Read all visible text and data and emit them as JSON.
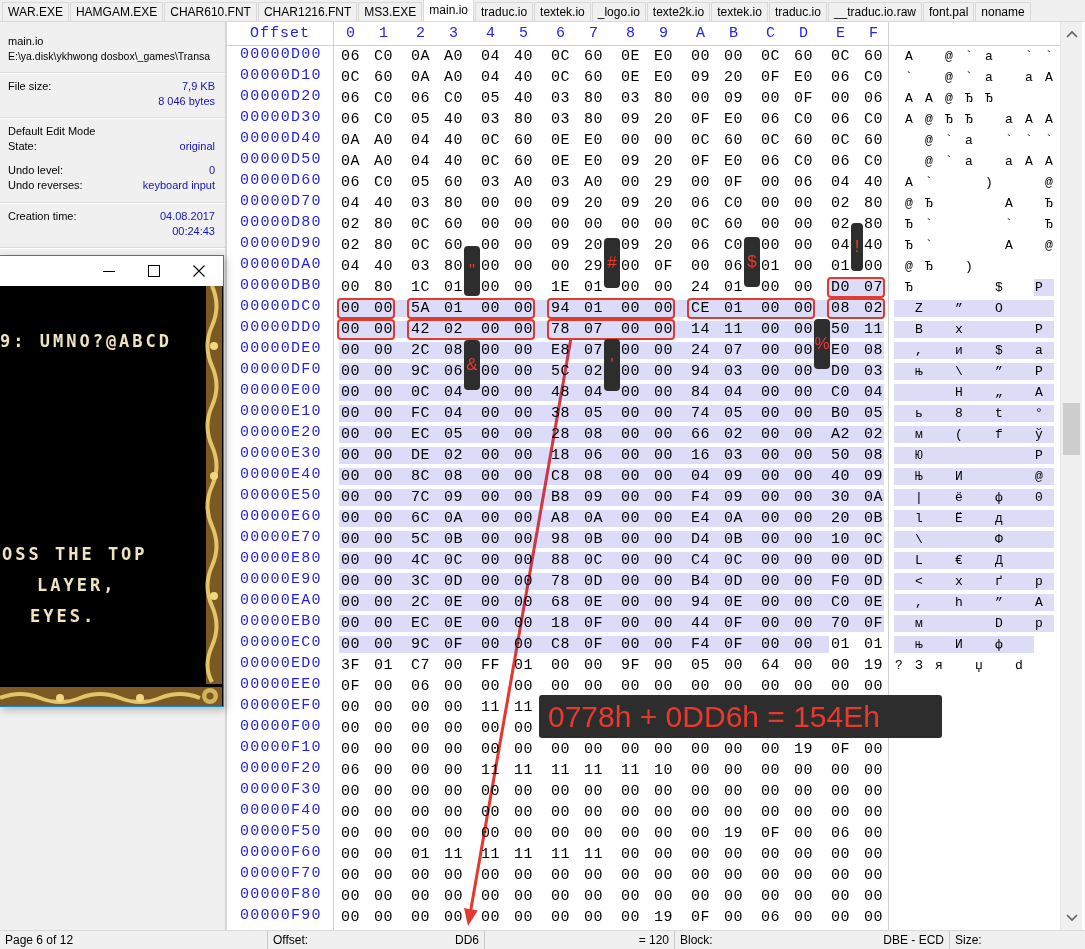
{
  "tabs": [
    {
      "label": "WAR.EXE",
      "selected": false
    },
    {
      "label": "HAMGAM.EXE",
      "selected": false
    },
    {
      "label": "CHAR610.FNT",
      "selected": false
    },
    {
      "label": "CHAR1216.FNT",
      "selected": false
    },
    {
      "label": "MS3.EXE",
      "selected": false
    },
    {
      "label": "main.io",
      "selected": true
    },
    {
      "label": "traduc.io",
      "selected": false
    },
    {
      "label": "textek.io",
      "selected": false
    },
    {
      "label": "_logo.io",
      "selected": false
    },
    {
      "label": "texte2k.io",
      "selected": false
    },
    {
      "label": "textek.io",
      "selected": false
    },
    {
      "label": "traduc.io",
      "selected": false
    },
    {
      "label": "__traduc.io.raw",
      "selected": false
    },
    {
      "label": "font.pal",
      "selected": false
    },
    {
      "label": "noname",
      "selected": false
    }
  ],
  "info_panel": {
    "file_name": "main.io",
    "path": "E:\\ya.disk\\ykhwong dosbox\\_games\\Transa",
    "file_size_label": "File size:",
    "file_size_kb": "7,9 KB",
    "file_size_bytes": "8 046 bytes",
    "edit_mode": "Default Edit Mode",
    "state_label": "State:",
    "state": "original",
    "undo_level_label": "Undo level:",
    "undo_level": "0",
    "undo_reverses_label": "Undo reverses:",
    "undo_reverses": "keyboard input",
    "creation_time_label": "Creation time:",
    "creation_date": "04.08.2017",
    "creation_clock": "00:24:43"
  },
  "overlay_window": {
    "lines": [
      "9: UMNO?@ABCD",
      "OSS THE TOP",
      "LAYER,",
      "EYES."
    ]
  },
  "hex_view": {
    "offset_header": "Offset",
    "column_headers": [
      "0",
      "1",
      "2",
      "3",
      "4",
      "5",
      "6",
      "7",
      "8",
      "9",
      "A",
      "B",
      "C",
      "D",
      "E",
      "F"
    ],
    "rows": [
      {
        "offset": "00000D00",
        "bytes": [
          "06",
          "C0",
          "0A",
          "A0",
          "04",
          "40",
          "0C",
          "60",
          "0E",
          "E0",
          "00",
          "00",
          "0C",
          "60",
          "0C",
          "60"
        ],
        "selected": [
          false,
          false,
          false,
          false,
          false,
          false,
          false,
          false,
          false,
          false,
          false,
          false,
          false,
          false,
          false,
          false
        ],
        "text": [
          " А   @ ` а   ` `"
        ]
      },
      {
        "offset": "00000D10",
        "bytes": [
          "0C",
          "60",
          "0A",
          "A0",
          "04",
          "40",
          "0C",
          "60",
          "0E",
          "E0",
          "09",
          "20",
          "0F",
          "E0",
          "06",
          "C0"
        ],
        "selected": [
          false,
          false,
          false,
          false,
          false,
          false,
          false,
          false,
          false,
          false,
          false,
          false,
          false,
          false,
          false,
          false
        ],
        "text": [
          " `   @ ` а   а А"
        ]
      },
      {
        "offset": "00000D20",
        "bytes": [
          "06",
          "C0",
          "06",
          "C0",
          "05",
          "40",
          "03",
          "80",
          "03",
          "80",
          "00",
          "09",
          "00",
          "0F",
          "00",
          "06"
        ],
        "selected": [
          false,
          false,
          false,
          false,
          false,
          false,
          false,
          false,
          false,
          false,
          false,
          false,
          false,
          false,
          false,
          false
        ],
        "text": [
          " А А @ Ђ Ђ"
        ]
      },
      {
        "offset": "00000D30",
        "bytes": [
          "06",
          "C0",
          "05",
          "40",
          "03",
          "80",
          "03",
          "80",
          "09",
          "20",
          "0F",
          "E0",
          "06",
          "C0",
          "06",
          "C0"
        ],
        "selected": [
          false,
          false,
          false,
          false,
          false,
          false,
          false,
          false,
          false,
          false,
          false,
          false,
          false,
          false,
          false,
          false
        ],
        "text": [
          " А @ Ђ Ђ   а А А"
        ]
      },
      {
        "offset": "00000D40",
        "bytes": [
          "0A",
          "A0",
          "04",
          "40",
          "0C",
          "60",
          "0E",
          "E0",
          "00",
          "00",
          "0C",
          "60",
          "0C",
          "60",
          "0C",
          "60"
        ],
        "selected": [
          false,
          false,
          false,
          false,
          false,
          false,
          false,
          false,
          false,
          false,
          false,
          false,
          false,
          false,
          false,
          false
        ],
        "text": [
          "   @ ` а   ` ` `"
        ]
      },
      {
        "offset": "00000D50",
        "bytes": [
          "0A",
          "A0",
          "04",
          "40",
          "0C",
          "60",
          "0E",
          "E0",
          "09",
          "20",
          "0F",
          "E0",
          "06",
          "C0",
          "06",
          "C0"
        ],
        "selected": [
          false,
          false,
          false,
          false,
          false,
          false,
          false,
          false,
          false,
          false,
          false,
          false,
          false,
          false,
          false,
          false
        ],
        "text": [
          "   @ ` а   а А А"
        ]
      },
      {
        "offset": "00000D60",
        "bytes": [
          "06",
          "C0",
          "05",
          "60",
          "03",
          "A0",
          "03",
          "A0",
          "00",
          "29",
          "00",
          "0F",
          "00",
          "06",
          "04",
          "40"
        ],
        "selected": [
          false,
          false,
          false,
          false,
          false,
          false,
          false,
          false,
          false,
          false,
          false,
          false,
          false,
          false,
          false,
          false
        ],
        "text": [
          " А `     )     @"
        ]
      },
      {
        "offset": "00000D70",
        "bytes": [
          "04",
          "40",
          "03",
          "80",
          "00",
          "00",
          "09",
          "20",
          "09",
          "20",
          "06",
          "C0",
          "00",
          "00",
          "02",
          "80"
        ],
        "selected": [
          false,
          false,
          false,
          false,
          false,
          false,
          false,
          false,
          false,
          false,
          false,
          false,
          false,
          false,
          false,
          false
        ],
        "text": [
          " @ Ђ       А   Ђ"
        ]
      },
      {
        "offset": "00000D80",
        "bytes": [
          "02",
          "80",
          "0C",
          "60",
          "00",
          "00",
          "00",
          "00",
          "00",
          "00",
          "0C",
          "60",
          "00",
          "00",
          "02",
          "80"
        ],
        "selected": [
          false,
          false,
          false,
          false,
          false,
          false,
          false,
          false,
          false,
          false,
          false,
          false,
          false,
          false,
          false,
          false
        ],
        "text": [
          " Ђ `       `   Ђ"
        ]
      },
      {
        "offset": "00000D90",
        "bytes": [
          "02",
          "80",
          "0C",
          "60",
          "00",
          "00",
          "09",
          "20",
          "09",
          "20",
          "06",
          "C0",
          "00",
          "00",
          "04",
          "40"
        ],
        "selected": [
          false,
          false,
          false,
          false,
          false,
          false,
          false,
          false,
          false,
          false,
          false,
          false,
          false,
          false,
          false,
          false
        ],
        "text": [
          " Ђ `       А   @"
        ]
      },
      {
        "offset": "00000DA0",
        "bytes": [
          "04",
          "40",
          "03",
          "80",
          "00",
          "00",
          "00",
          "29",
          "00",
          "0F",
          "00",
          "06",
          "01",
          "00",
          "01",
          "00"
        ],
        "selected": [
          false,
          false,
          false,
          false,
          false,
          false,
          false,
          false,
          false,
          false,
          false,
          false,
          false,
          false,
          false,
          false
        ],
        "text": [
          " @ Ђ   )"
        ]
      },
      {
        "offset": "00000DB0",
        "bytes": [
          "00",
          "80",
          "1C",
          "01",
          "00",
          "00",
          "1E",
          "01",
          "00",
          "00",
          "24",
          "01",
          "00",
          "00",
          "D0",
          "07"
        ],
        "selected": [
          false,
          false,
          false,
          false,
          false,
          false,
          false,
          false,
          false,
          false,
          false,
          false,
          false,
          false,
          true,
          true
        ],
        "text": [
          " Ђ",
          "        $   Р"
        ]
      },
      {
        "offset": "00000DC0",
        "bytes": [
          "00",
          "00",
          "5A",
          "01",
          "00",
          "00",
          "94",
          "01",
          "00",
          "00",
          "CE",
          "01",
          "00",
          "00",
          "08",
          "02"
        ],
        "selected": [
          true,
          true,
          true,
          true,
          true,
          true,
          true,
          true,
          true,
          true,
          true,
          true,
          true,
          true,
          true,
          true
        ],
        "text": [
          "  Z   ”   О"
        ]
      },
      {
        "offset": "00000DD0",
        "bytes": [
          "00",
          "00",
          "42",
          "02",
          "00",
          "00",
          "78",
          "07",
          "00",
          "00",
          "14",
          "11",
          "00",
          "00",
          "50",
          "11"
        ],
        "selected": [
          true,
          true,
          true,
          true,
          true,
          true,
          true,
          true,
          true,
          true,
          true,
          true,
          true,
          true,
          true,
          true
        ],
        "text": [
          "  B   x       P"
        ]
      },
      {
        "offset": "00000DE0",
        "bytes": [
          "00",
          "00",
          "2C",
          "08",
          "00",
          "00",
          "E8",
          "07",
          "00",
          "00",
          "24",
          "07",
          "00",
          "00",
          "E0",
          "08"
        ],
        "selected": [
          true,
          true,
          true,
          true,
          true,
          true,
          true,
          true,
          true,
          true,
          true,
          true,
          true,
          true,
          true,
          true
        ],
        "text": [
          "  ,   и   $   а"
        ]
      },
      {
        "offset": "00000DF0",
        "bytes": [
          "00",
          "00",
          "9C",
          "06",
          "00",
          "00",
          "5C",
          "02",
          "00",
          "00",
          "94",
          "03",
          "00",
          "00",
          "D0",
          "03"
        ],
        "selected": [
          true,
          true,
          true,
          true,
          true,
          true,
          true,
          true,
          true,
          true,
          true,
          true,
          true,
          true,
          true,
          true
        ],
        "text": [
          "  њ   \\   ”   Р"
        ]
      },
      {
        "offset": "00000E00",
        "bytes": [
          "00",
          "00",
          "0C",
          "04",
          "00",
          "00",
          "48",
          "04",
          "00",
          "00",
          "84",
          "04",
          "00",
          "00",
          "C0",
          "04"
        ],
        "selected": [
          true,
          true,
          true,
          true,
          true,
          true,
          true,
          true,
          true,
          true,
          true,
          true,
          true,
          true,
          true,
          true
        ],
        "text": [
          "      H   „   А"
        ]
      },
      {
        "offset": "00000E10",
        "bytes": [
          "00",
          "00",
          "FC",
          "04",
          "00",
          "00",
          "38",
          "05",
          "00",
          "00",
          "74",
          "05",
          "00",
          "00",
          "B0",
          "05"
        ],
        "selected": [
          true,
          true,
          true,
          true,
          true,
          true,
          true,
          true,
          true,
          true,
          true,
          true,
          true,
          true,
          true,
          true
        ],
        "text": [
          "  ь   8   t   °"
        ]
      },
      {
        "offset": "00000E20",
        "bytes": [
          "00",
          "00",
          "EC",
          "05",
          "00",
          "00",
          "28",
          "08",
          "00",
          "00",
          "66",
          "02",
          "00",
          "00",
          "A2",
          "02"
        ],
        "selected": [
          true,
          true,
          true,
          true,
          true,
          true,
          true,
          true,
          true,
          true,
          true,
          true,
          true,
          true,
          true,
          true
        ],
        "text": [
          "  м   (   f   ў"
        ]
      },
      {
        "offset": "00000E30",
        "bytes": [
          "00",
          "00",
          "DE",
          "02",
          "00",
          "00",
          "18",
          "06",
          "00",
          "00",
          "16",
          "03",
          "00",
          "00",
          "50",
          "08"
        ],
        "selected": [
          true,
          true,
          true,
          true,
          true,
          true,
          true,
          true,
          true,
          true,
          true,
          true,
          true,
          true,
          true,
          true
        ],
        "text": [
          "  Ю",
          "           P"
        ]
      },
      {
        "offset": "00000E40",
        "bytes": [
          "00",
          "00",
          "8C",
          "08",
          "00",
          "00",
          "C8",
          "08",
          "00",
          "00",
          "04",
          "09",
          "00",
          "00",
          "40",
          "09"
        ],
        "selected": [
          true,
          true,
          true,
          true,
          true,
          true,
          true,
          true,
          true,
          true,
          true,
          true,
          true,
          true,
          true,
          true
        ],
        "text": [
          "  Њ   И       @"
        ]
      },
      {
        "offset": "00000E50",
        "bytes": [
          "00",
          "00",
          "7C",
          "09",
          "00",
          "00",
          "B8",
          "09",
          "00",
          "00",
          "F4",
          "09",
          "00",
          "00",
          "30",
          "0A"
        ],
        "selected": [
          true,
          true,
          true,
          true,
          true,
          true,
          true,
          true,
          true,
          true,
          true,
          true,
          true,
          true,
          true,
          true
        ],
        "text": [
          "  |   ё   ф   0"
        ]
      },
      {
        "offset": "00000E60",
        "bytes": [
          "00",
          "00",
          "6C",
          "0A",
          "00",
          "00",
          "A8",
          "0A",
          "00",
          "00",
          "E4",
          "0A",
          "00",
          "00",
          "20",
          "0B"
        ],
        "selected": [
          true,
          true,
          true,
          true,
          true,
          true,
          true,
          true,
          true,
          true,
          true,
          true,
          true,
          true,
          true,
          true
        ],
        "text": [
          "  l   Ё   д"
        ]
      },
      {
        "offset": "00000E70",
        "bytes": [
          "00",
          "00",
          "5C",
          "0B",
          "00",
          "00",
          "98",
          "0B",
          "00",
          "00",
          "D4",
          "0B",
          "00",
          "00",
          "10",
          "0C"
        ],
        "selected": [
          true,
          true,
          true,
          true,
          true,
          true,
          true,
          true,
          true,
          true,
          true,
          true,
          true,
          true,
          true,
          true
        ],
        "text": [
          "  \\       Ф"
        ]
      },
      {
        "offset": "00000E80",
        "bytes": [
          "00",
          "00",
          "4C",
          "0C",
          "00",
          "00",
          "88",
          "0C",
          "00",
          "00",
          "C4",
          "0C",
          "00",
          "00",
          "00",
          "0D"
        ],
        "selected": [
          true,
          true,
          true,
          true,
          true,
          true,
          true,
          true,
          true,
          true,
          true,
          true,
          true,
          true,
          true,
          true
        ],
        "text": [
          "  L   €   Д"
        ]
      },
      {
        "offset": "00000E90",
        "bytes": [
          "00",
          "00",
          "3C",
          "0D",
          "00",
          "00",
          "78",
          "0D",
          "00",
          "00",
          "B4",
          "0D",
          "00",
          "00",
          "F0",
          "0D"
        ],
        "selected": [
          true,
          true,
          true,
          true,
          true,
          true,
          true,
          true,
          true,
          true,
          true,
          true,
          true,
          true,
          true,
          true
        ],
        "text": [
          "  <   x   ґ   р"
        ]
      },
      {
        "offset": "00000EA0",
        "bytes": [
          "00",
          "00",
          "2C",
          "0E",
          "00",
          "00",
          "68",
          "0E",
          "00",
          "00",
          "94",
          "0E",
          "00",
          "00",
          "C0",
          "0E"
        ],
        "selected": [
          true,
          true,
          true,
          true,
          true,
          true,
          true,
          true,
          true,
          true,
          true,
          true,
          true,
          true,
          true,
          true
        ],
        "text": [
          "  ,   h   ”   А"
        ]
      },
      {
        "offset": "00000EB0",
        "bytes": [
          "00",
          "00",
          "EC",
          "0E",
          "00",
          "00",
          "18",
          "0F",
          "00",
          "00",
          "44",
          "0F",
          "00",
          "00",
          "70",
          "0F"
        ],
        "selected": [
          true,
          true,
          true,
          true,
          true,
          true,
          true,
          true,
          true,
          true,
          true,
          true,
          true,
          true,
          true,
          true
        ],
        "text": [
          "  м       D   p"
        ]
      },
      {
        "offset": "00000EC0",
        "bytes": [
          "00",
          "00",
          "9C",
          "0F",
          "00",
          "00",
          "C8",
          "0F",
          "00",
          "00",
          "F4",
          "0F",
          "00",
          "00",
          "01",
          "01"
        ],
        "selected": [
          true,
          true,
          true,
          true,
          true,
          true,
          true,
          true,
          true,
          true,
          true,
          true,
          true,
          true,
          false,
          false
        ],
        "text": [
          "  њ   И   ф"
        ]
      },
      {
        "offset": "00000ED0",
        "bytes": [
          "3F",
          "01",
          "C7",
          "00",
          "FF",
          "01",
          "00",
          "00",
          "9F",
          "00",
          "05",
          "00",
          "64",
          "00",
          "00",
          "19"
        ],
        "selected": [
          false,
          false,
          false,
          false,
          false,
          false,
          false,
          false,
          false,
          false,
          false,
          false,
          false,
          false,
          false,
          false
        ],
        "text": [
          "? З я   џ   d"
        ]
      },
      {
        "offset": "00000EE0",
        "bytes": [
          "0F",
          "00",
          "06",
          "00",
          "00",
          "00",
          "00",
          "00",
          "00",
          "00",
          "00",
          "00",
          "00",
          "00",
          "00",
          "00"
        ],
        "selected": [
          false,
          false,
          false,
          false,
          false,
          false,
          false,
          false,
          false,
          false,
          false,
          false,
          false,
          false,
          false,
          false
        ]
      },
      {
        "offset": "00000EF0",
        "bytes": [
          "00",
          "00",
          "00",
          "00",
          "11",
          "11"
        ],
        "selected": [
          false,
          false,
          false,
          false,
          false,
          false
        ]
      },
      {
        "offset": "00000F00",
        "bytes": [
          "00",
          "00",
          "00",
          "00",
          "00",
          "00"
        ],
        "selected": [
          false,
          false,
          false,
          false,
          false,
          false
        ]
      },
      {
        "offset": "00000F10",
        "bytes": [
          "00",
          "00",
          "00",
          "00",
          "00",
          "00",
          "00",
          "00",
          "00",
          "00",
          "00",
          "00",
          "00",
          "19",
          "0F",
          "00"
        ],
        "selected": [
          false,
          false,
          false,
          false,
          false,
          false,
          false,
          false,
          false,
          false,
          false,
          false,
          false,
          false,
          false,
          false
        ]
      },
      {
        "offset": "00000F20",
        "bytes": [
          "06",
          "00",
          "00",
          "00",
          "11",
          "11",
          "11",
          "11",
          "11",
          "10",
          "00",
          "00",
          "00",
          "00",
          "00",
          "00"
        ],
        "selected": [
          false,
          false,
          false,
          false,
          false,
          false,
          false,
          false,
          false,
          false,
          false,
          false,
          false,
          false,
          false,
          false
        ]
      },
      {
        "offset": "00000F30",
        "bytes": [
          "00",
          "00",
          "00",
          "00",
          "00",
          "00",
          "00",
          "00",
          "00",
          "00",
          "00",
          "00",
          "00",
          "00",
          "00",
          "00"
        ],
        "selected": [
          false,
          false,
          false,
          false,
          false,
          false,
          false,
          false,
          false,
          false,
          false,
          false,
          false,
          false,
          false,
          false
        ]
      },
      {
        "offset": "00000F40",
        "bytes": [
          "00",
          "00",
          "00",
          "00",
          "00",
          "00",
          "00",
          "00",
          "00",
          "00",
          "00",
          "00",
          "00",
          "00",
          "00",
          "00"
        ],
        "selected": [
          false,
          false,
          false,
          false,
          false,
          false,
          false,
          false,
          false,
          false,
          false,
          false,
          false,
          false,
          false,
          false
        ]
      },
      {
        "offset": "00000F50",
        "bytes": [
          "00",
          "00",
          "00",
          "00",
          "00",
          "00",
          "00",
          "00",
          "00",
          "00",
          "00",
          "19",
          "0F",
          "00",
          "06",
          "00"
        ],
        "selected": [
          false,
          false,
          false,
          false,
          false,
          false,
          false,
          false,
          false,
          false,
          false,
          false,
          false,
          false,
          false,
          false
        ]
      },
      {
        "offset": "00000F60",
        "bytes": [
          "00",
          "00",
          "01",
          "11",
          "11",
          "11",
          "11",
          "11",
          "00",
          "00",
          "00",
          "00",
          "00",
          "00",
          "00",
          "00"
        ],
        "selected": [
          false,
          false,
          false,
          false,
          false,
          false,
          false,
          false,
          false,
          false,
          false,
          false,
          false,
          false,
          false,
          false
        ]
      },
      {
        "offset": "00000F70",
        "bytes": [
          "00",
          "00",
          "00",
          "00",
          "00",
          "00",
          "00",
          "00",
          "00",
          "00",
          "00",
          "00",
          "00",
          "00",
          "00",
          "00"
        ],
        "selected": [
          false,
          false,
          false,
          false,
          false,
          false,
          false,
          false,
          false,
          false,
          false,
          false,
          false,
          false,
          false,
          false
        ]
      },
      {
        "offset": "00000F80",
        "bytes": [
          "00",
          "00",
          "00",
          "00",
          "00",
          "00",
          "00",
          "00",
          "00",
          "00",
          "00",
          "00",
          "00",
          "00",
          "00",
          "00"
        ],
        "selected": [
          false,
          false,
          false,
          false,
          false,
          false,
          false,
          false,
          false,
          false,
          false,
          false,
          false,
          false,
          false,
          false
        ]
      },
      {
        "offset": "00000F90",
        "bytes": [
          "00",
          "00",
          "00",
          "00",
          "00",
          "00",
          "00",
          "00",
          "00",
          "19",
          "0F",
          "00",
          "06",
          "00",
          "00",
          "00"
        ],
        "selected": [
          false,
          false,
          false,
          false,
          false,
          false,
          false,
          false,
          false,
          false,
          false,
          false,
          false,
          false,
          false,
          false
        ]
      }
    ]
  },
  "annotations": {
    "labels": [
      "\"",
      "#",
      "$",
      "!",
      "%",
      "&",
      "'"
    ],
    "equation": "0778h + 0DD6h = 154Eh"
  },
  "status_bar": {
    "page": "Page 6 of 12",
    "offset_label": "Offset:",
    "offset": "DD6",
    "value": "= 120",
    "block_label": "Block:",
    "block": "DBE - ECD",
    "size_label": "Size:"
  }
}
